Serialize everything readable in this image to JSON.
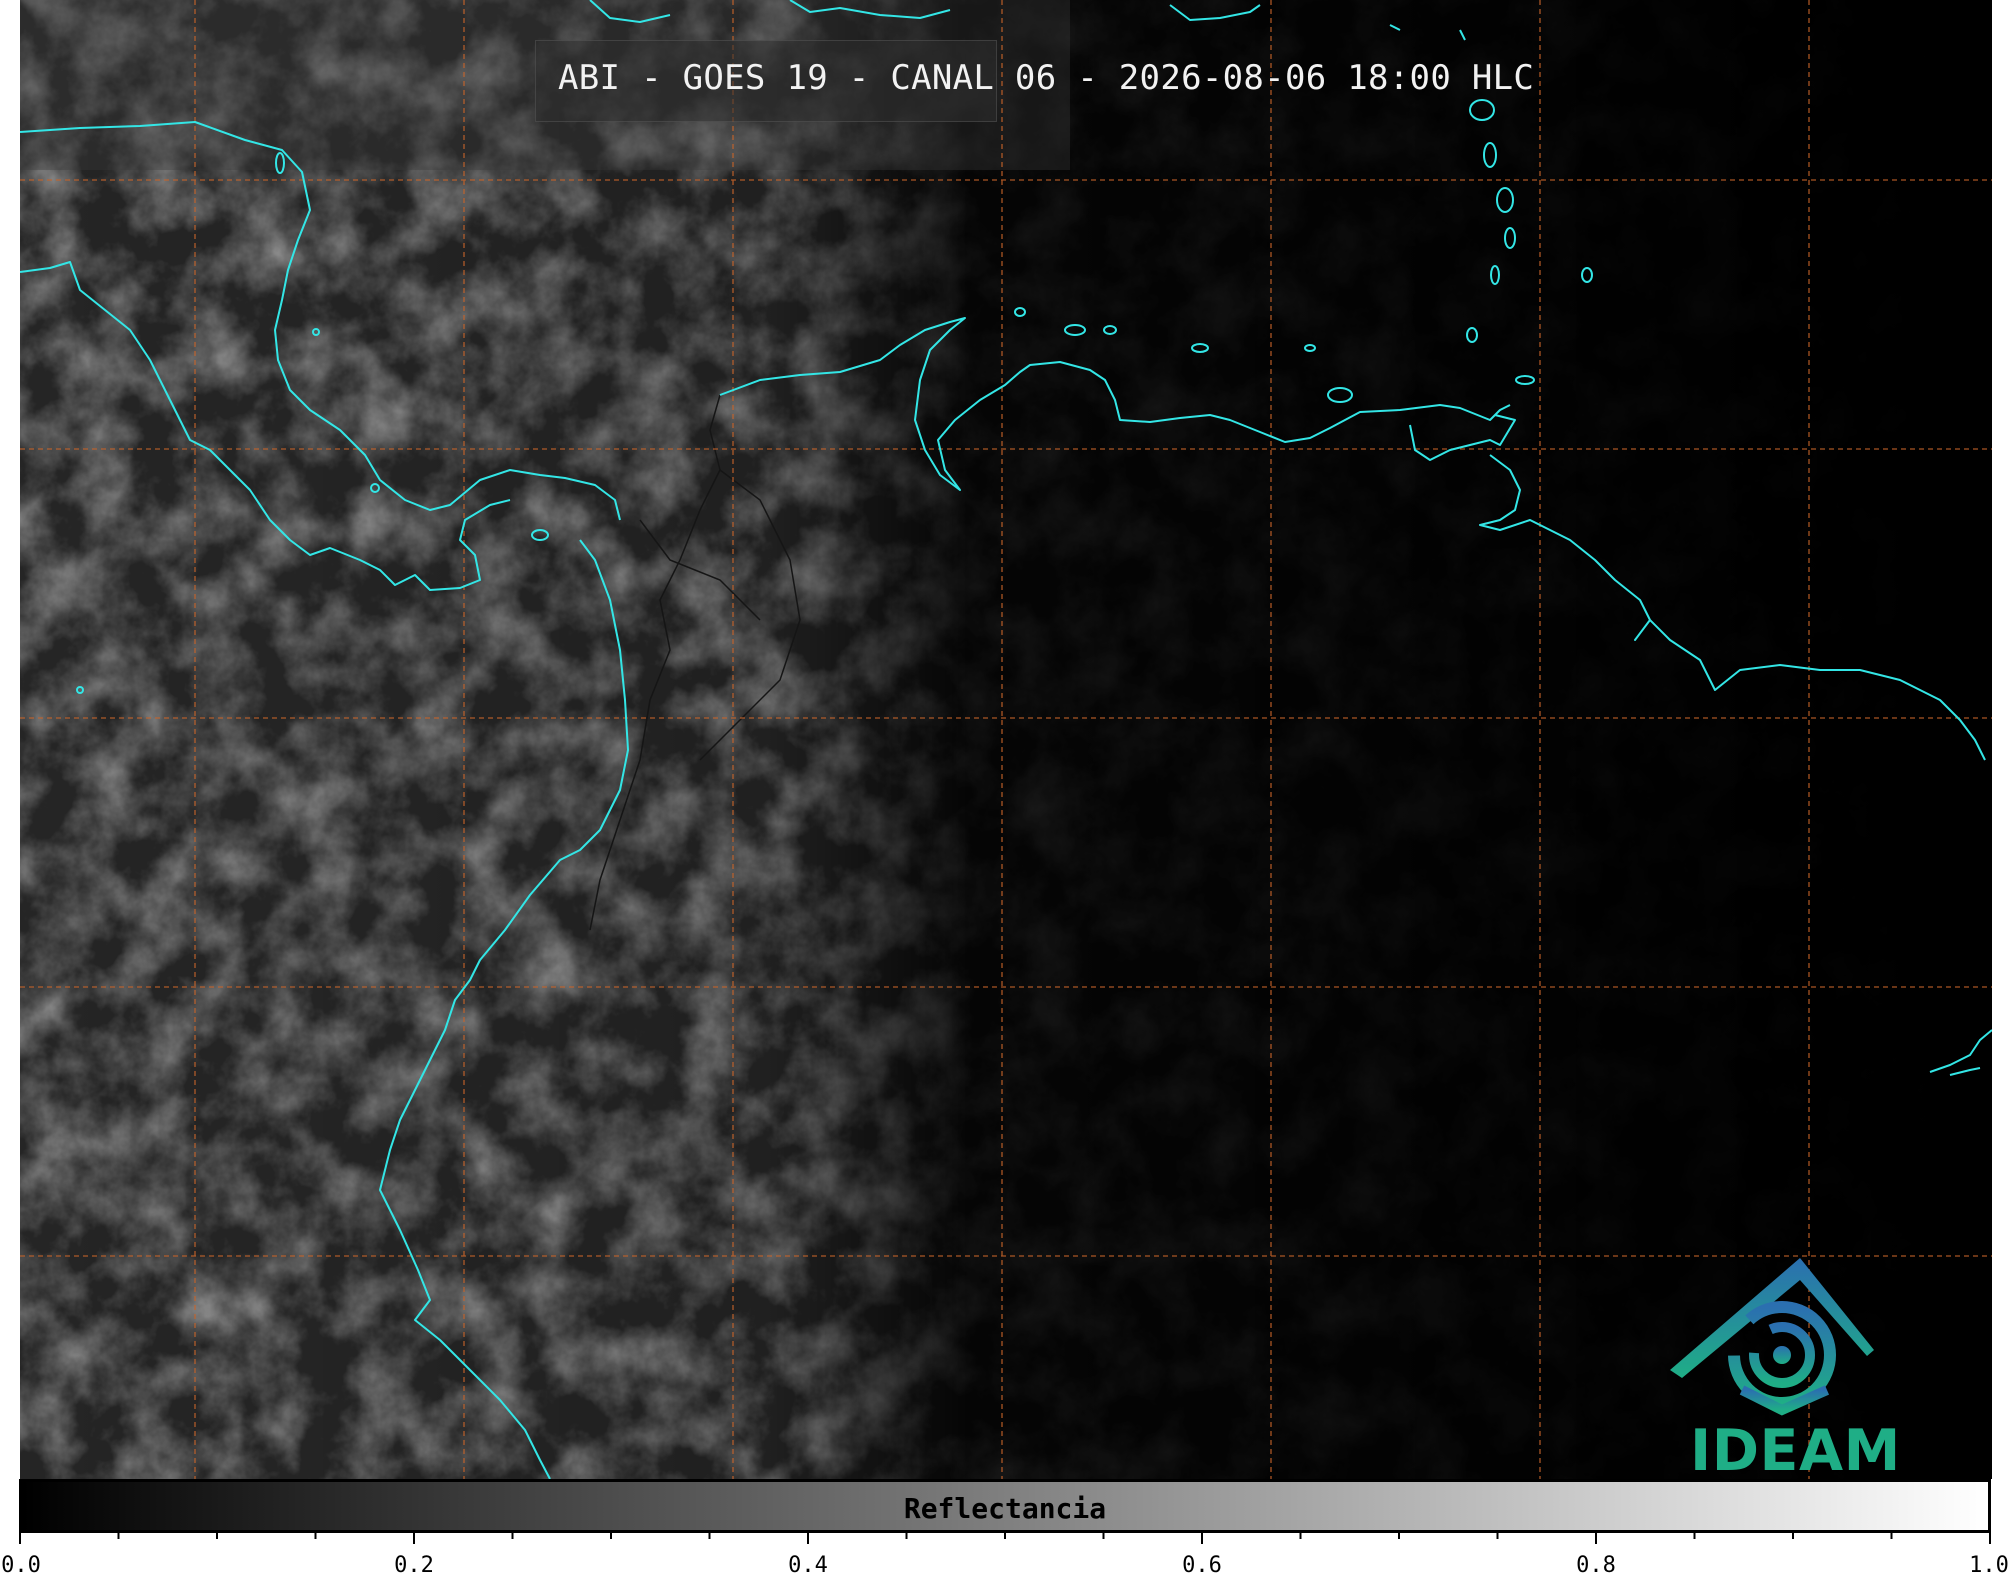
{
  "title": "ABI - GOES 19 - CANAL 06 - 2026-08-06 18:00 HLC",
  "colorbar": {
    "label": "Reflectancia",
    "ticks": [
      "0.0",
      "0.2",
      "0.4",
      "0.6",
      "0.8",
      "1.0"
    ],
    "min": 0.0,
    "max": 1.0,
    "cmap": [
      "#000000",
      "#ffffff"
    ]
  },
  "logo": {
    "text": "IDEAM"
  },
  "colors": {
    "coastline": "#33e6e6",
    "gridlines": "#c8642a",
    "borders": "#1a1a1a"
  }
}
